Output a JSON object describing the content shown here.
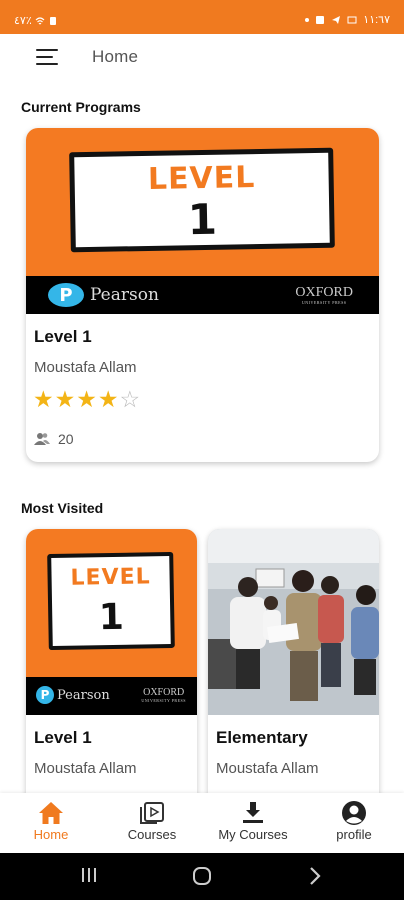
{
  "status_bar": {
    "time": "١١:٦٧",
    "left_text": "٤٧٪"
  },
  "app_bar": {
    "title": "Home"
  },
  "sections": {
    "current": "Current Programs",
    "most_visited": "Most Visited"
  },
  "colors": {
    "accent": "#f07a1f",
    "star": "#f3b416"
  },
  "current_program": {
    "banner": {
      "level_text": "LEVEL",
      "level_num": "1",
      "pearson": "Pearson",
      "oxford": "OXFORD",
      "oxford_sub": "UNIVERSITY PRESS"
    },
    "title": "Level 1",
    "author": "Moustafa Allam",
    "rating": 4,
    "max_rating": 5,
    "students": "20"
  },
  "most_visited": [
    {
      "banner": {
        "level_text": "LEVEL",
        "level_num": "1",
        "pearson": "Pearson",
        "oxford": "OXFORD",
        "oxford_sub": "UNIVERSITY PRESS"
      },
      "title": "Level 1",
      "author": "Moustafa Allam"
    },
    {
      "title": "Elementary",
      "author": "Moustafa Allam"
    }
  ],
  "bottom_nav": [
    {
      "label": "Home",
      "icon": "home-icon",
      "active": true
    },
    {
      "label": "Courses",
      "icon": "video-library-icon",
      "active": false
    },
    {
      "label": "My Courses",
      "icon": "download-icon",
      "active": false
    },
    {
      "label": "profile",
      "icon": "account-circle-icon",
      "active": false
    }
  ]
}
